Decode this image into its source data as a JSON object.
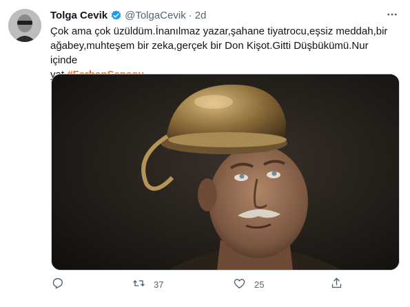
{
  "tweet": {
    "author_name": "Tolga Cevik",
    "handle": "@TolgaCevik",
    "separator": "·",
    "time": "2d",
    "text_line1": "Çok ama çok üzüldüm.İnanılmaz yazar,şahane tiyatrocu,eşsiz meddah,bir",
    "text_line2": "ağabey,muhteşem bir zeka,gerçek bir Don Kişot.Gitti Düşbükümü.Nur içinde",
    "text_line3_prefix": "yat ",
    "hashtag": "#FerhanŞensoy"
  },
  "actions": {
    "reply_icon": "reply-icon",
    "retweet_icon": "retweet-icon",
    "retweet_count": "37",
    "like_icon": "heart-icon",
    "like_count": "25",
    "share_icon": "share-icon"
  },
  "colors": {
    "hashtag": "#e6742f",
    "verified": "#1d9bf0",
    "secondary_text": "#536471"
  }
}
